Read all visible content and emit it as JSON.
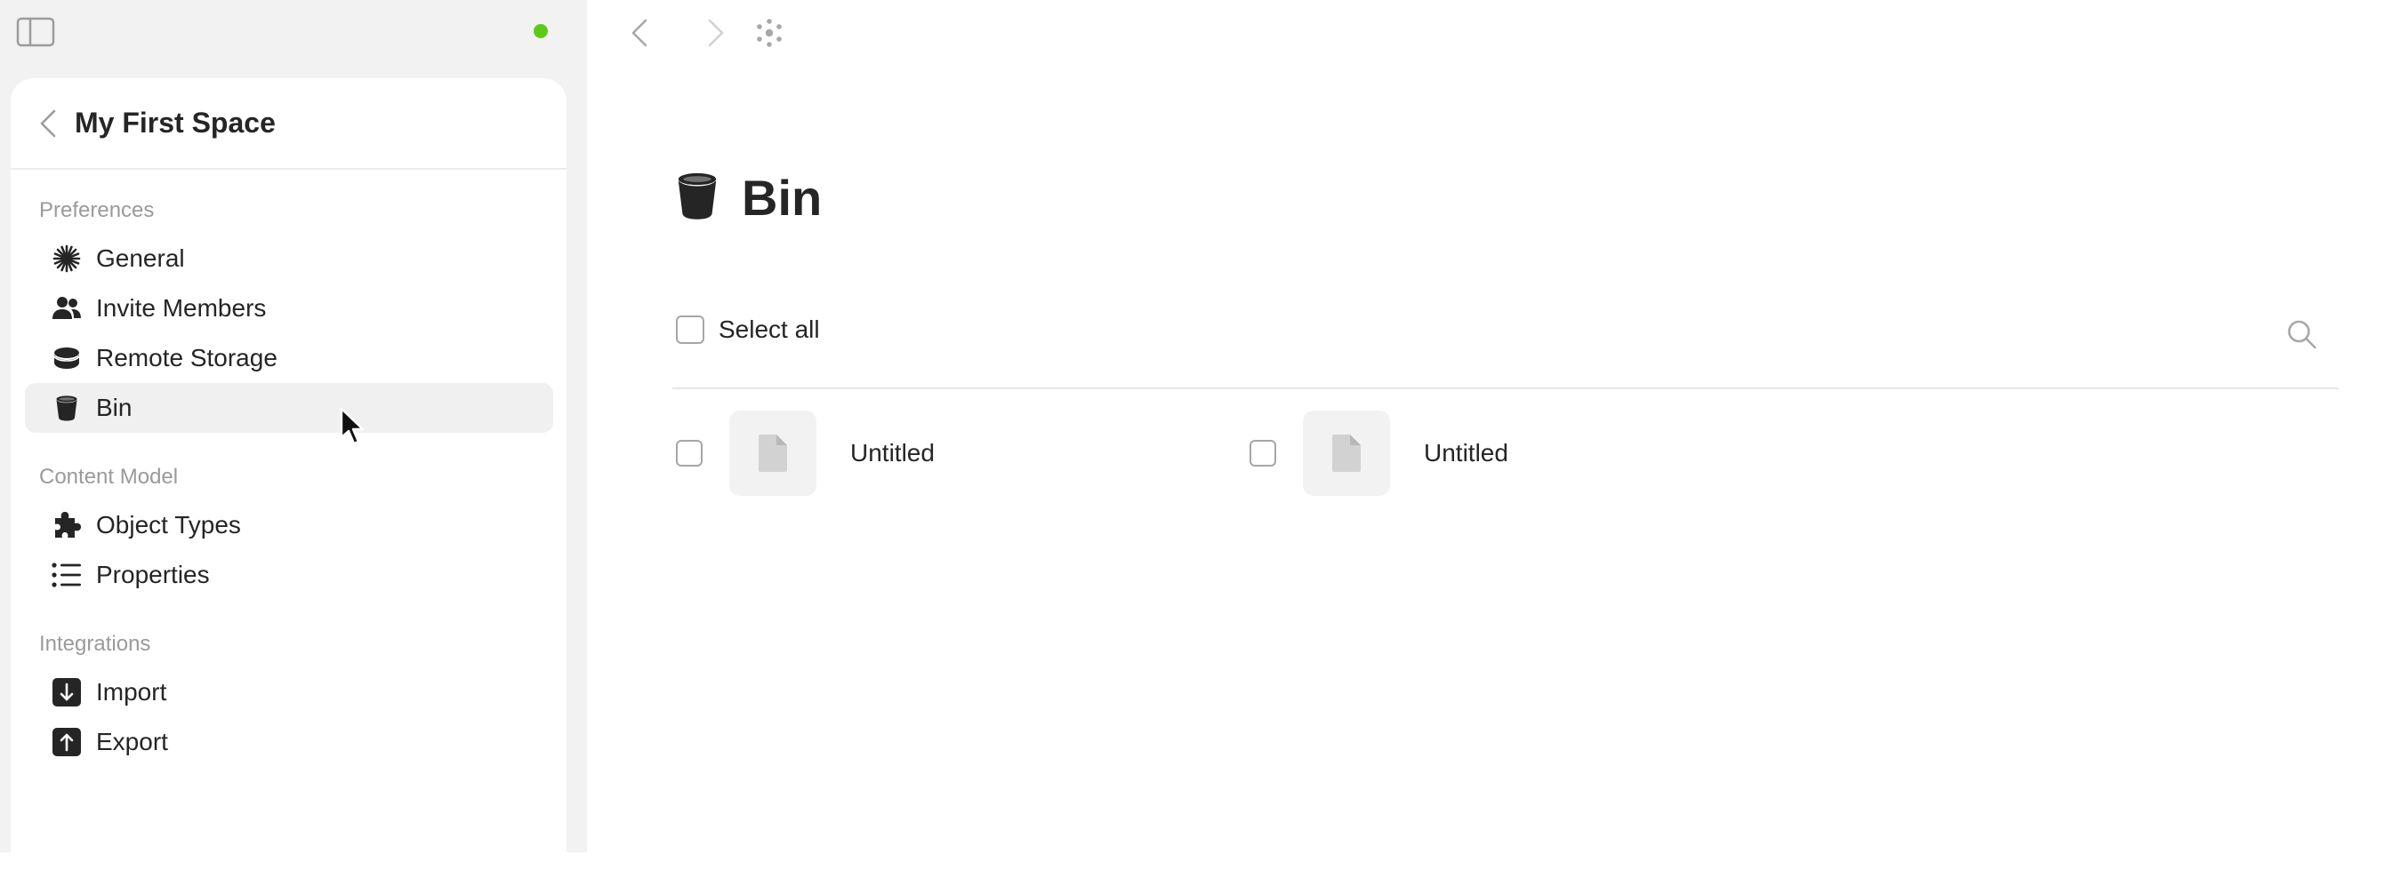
{
  "toolbar": {
    "sidebar_toggle_icon": "sidebar-toggle-icon",
    "back_icon": "chevron-left-icon",
    "forward_icon": "chevron-right-icon",
    "graph_icon": "graph-icon",
    "status_color": "#5dcb16"
  },
  "sidebar": {
    "space_name": "My First Space",
    "sections": [
      {
        "label": "Preferences",
        "items": [
          {
            "label": "General",
            "icon": "asterisk-icon"
          },
          {
            "label": "Invite Members",
            "icon": "members-icon"
          },
          {
            "label": "Remote Storage",
            "icon": "storage-icon"
          },
          {
            "label": "Bin",
            "icon": "bin-icon",
            "active": true
          }
        ]
      },
      {
        "label": "Content Model",
        "items": [
          {
            "label": "Object Types",
            "icon": "puzzle-icon"
          },
          {
            "label": "Properties",
            "icon": "list-icon"
          }
        ]
      },
      {
        "label": "Integrations",
        "items": [
          {
            "label": "Import",
            "icon": "import-icon"
          },
          {
            "label": "Export",
            "icon": "export-icon"
          }
        ]
      }
    ]
  },
  "main": {
    "title": "Bin",
    "title_icon": "bin-icon",
    "select_all_label": "Select all",
    "search_icon": "search-icon",
    "objects": [
      {
        "name": "Untitled",
        "icon": "document-icon",
        "checked": false
      },
      {
        "name": "Untitled",
        "icon": "document-icon",
        "checked": false
      }
    ]
  }
}
